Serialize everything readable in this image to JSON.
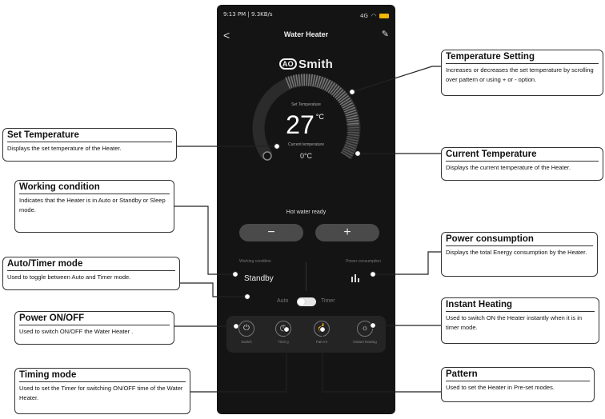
{
  "status_bar": {
    "left": "9:13 PM | 9.3KB/s",
    "right": "4G"
  },
  "header": {
    "back": "<",
    "title": "Water Heater",
    "edit": "✎"
  },
  "logo": {
    "mark": "AO",
    "text": "Smith"
  },
  "dial": {
    "set_label": "Set Temperature",
    "set_value": "27",
    "set_unit": "°C",
    "current_label": "Current temperature",
    "current_value": "0°C"
  },
  "status_message": "Hot water ready",
  "controls": {
    "minus": "−",
    "plus": "+"
  },
  "info": {
    "working_label": "Working condition",
    "power_label": "Power consumption",
    "working_value": "Standby"
  },
  "mode_toggle": {
    "left": "Auto",
    "right": "Timer"
  },
  "functions": [
    {
      "icon": "power-icon",
      "label": "Switch"
    },
    {
      "icon": "clock-icon",
      "label": "Timing"
    },
    {
      "icon": "hand-icon",
      "label": "Pattern"
    },
    {
      "icon": "sun-icon",
      "label": "Instant heating"
    }
  ],
  "callouts": {
    "temperature_setting": {
      "title": "Temperature Setting",
      "desc": "Increases or decreases the set  temperature by scrolling over pattern or using + or  - option."
    },
    "current_temperature": {
      "title": "Current Temperature",
      "desc": "Displays the current temperature of the Heater."
    },
    "power_consumption": {
      "title": "Power consumption",
      "desc": "Displays the total Energy consumption by the Heater."
    },
    "instant_heating": {
      "title": "Instant Heating",
      "desc": "Used to switch ON the Heater instantly when it is in timer mode."
    },
    "pattern": {
      "title": "Pattern",
      "desc": "Used to set the Heater in Pre-set modes."
    },
    "set_temperature": {
      "title": "Set Temperature",
      "desc": "Displays the set temperature of the Heater."
    },
    "working_condition": {
      "title": "Working condition",
      "desc": "Indicates that the Heater is in Auto or Standby or Sleep mode."
    },
    "auto_timer": {
      "title": "Auto/Timer mode",
      "desc": "Used to toggle between Auto and Timer mode."
    },
    "power_onoff": {
      "title": "Power ON/OFF",
      "desc": "Used to switch ON/OFF the Water Heater ."
    },
    "timing_mode": {
      "title": "Timing mode",
      "desc": "Used to set the Timer for switching  ON/OFF time of the Water Heater."
    }
  },
  "colors": {
    "app_bg": "#141414",
    "accent": "#f2b600",
    "card": "#242424"
  }
}
